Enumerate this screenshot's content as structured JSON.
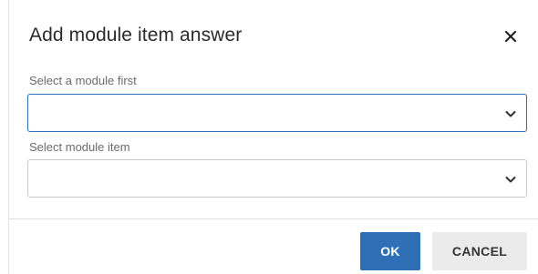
{
  "dialog": {
    "title": "Add module item answer",
    "close_icon": "close-icon",
    "fields": [
      {
        "label": "Select a module first",
        "value": "",
        "focused": true
      },
      {
        "label": "Select module item",
        "value": "",
        "focused": false
      }
    ],
    "buttons": {
      "ok": "OK",
      "cancel": "CANCEL"
    }
  },
  "colors": {
    "primary": "#2f6fb5",
    "secondary_button": "#ebebeb",
    "border": "#c9c9c9"
  }
}
